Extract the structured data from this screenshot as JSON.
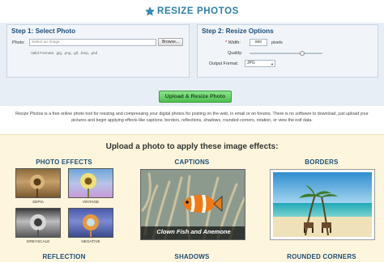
{
  "header": {
    "logo_text": "RESIZE PHOTOS",
    "logo_icon": "star-icon"
  },
  "step1": {
    "title": "Step 1: Select Photo",
    "photo_label": "Photo:",
    "photo_placeholder": "Select an Image",
    "browse_label": "Browse...",
    "formats": "Valid Formats: .jpg, .png, .gif, .bmp, .psd"
  },
  "step2": {
    "title": "Step 2: Resize Options",
    "width_label": "Width:",
    "width_required_mark": "*",
    "width_value": "800",
    "width_unit": "pixels",
    "quality_label": "Quality:",
    "quality_level": 0.72,
    "format_label": "Output Format:",
    "format_value": "JPG"
  },
  "upload_button": "Upload & Resize Photo",
  "description": "Resize Photos is a free online photo tool for resizing and compressing your digital photos for posting on the web, in email or on forums. There is no software to download, just upload your pictures and begin applying effects like captions, borders, reflections, shadows, rounded corners, rotation, or view the exif data.",
  "effects": {
    "title": "Upload a photo to apply these image effects:",
    "photo_effects_title": "PHOTO EFFECTS",
    "captions_title": "CAPTIONS",
    "borders_title": "BORDERS",
    "reflection_title": "REFLECTION",
    "shadows_title": "SHADOWS",
    "rounded_title": "ROUNDED CORNERS",
    "thumbs": [
      {
        "label": "SEPIA"
      },
      {
        "label": "VINTAGE"
      },
      {
        "label": "GREYSCALE"
      },
      {
        "label": "NEGATIVE"
      }
    ],
    "caption_text": "Clown Fish and Anemone"
  }
}
